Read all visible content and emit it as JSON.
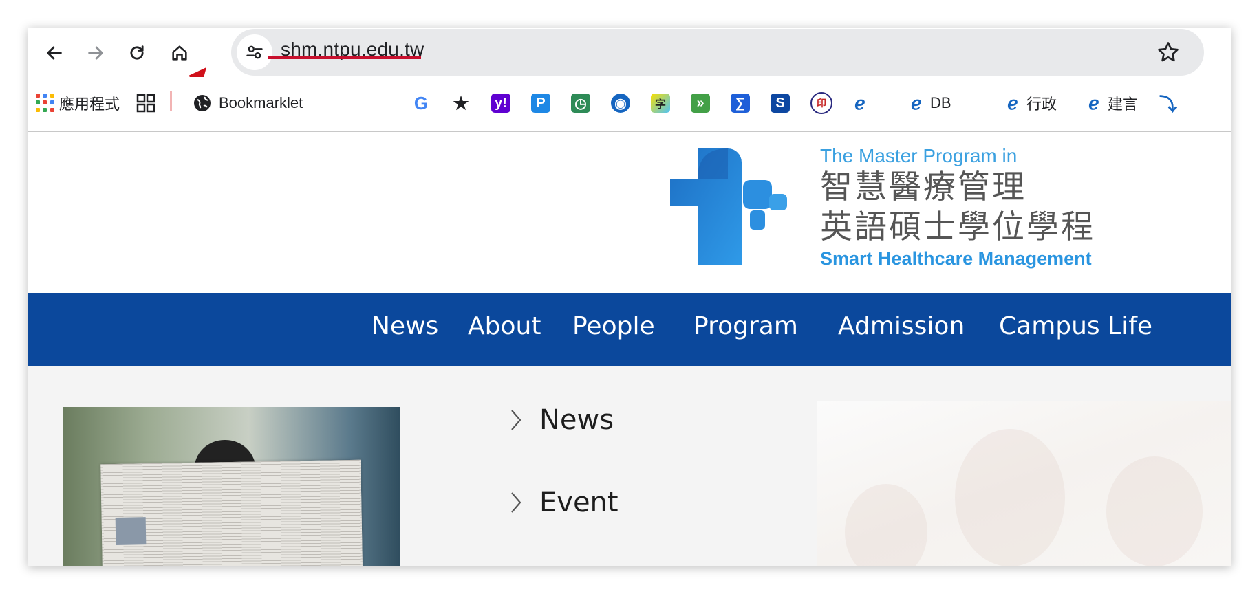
{
  "browser": {
    "url": "shm.ntpu.edu.tw",
    "bookmarks": [
      {
        "icon": "apps-grid-icon",
        "label": "應用程式"
      },
      {
        "icon": "grid-icon",
        "label": ""
      },
      {
        "icon": "globe-icon",
        "label": "Bookmarklet"
      },
      {
        "icon": "google-icon",
        "label": "",
        "glyph": "G",
        "color": "#4285f4"
      },
      {
        "icon": "star-icon",
        "label": "",
        "glyph": "★",
        "color": "#202124"
      },
      {
        "icon": "yahoo-icon",
        "label": "",
        "glyph": "y!",
        "color": "#5f01d1"
      },
      {
        "icon": "p-icon",
        "label": "",
        "glyph": "P",
        "color": "#1e88e5"
      },
      {
        "icon": "green-app-icon",
        "label": "",
        "glyph": "◷",
        "color": "#2e8b57"
      },
      {
        "icon": "eye-icon",
        "label": "",
        "glyph": "◉",
        "color": "#1565c0"
      },
      {
        "icon": "dictionary-icon",
        "label": "",
        "glyph": "字",
        "color": "#f1c40f"
      },
      {
        "icon": "forward-icon",
        "label": "",
        "glyph": "»",
        "color": "#43a047"
      },
      {
        "icon": "sigma-icon",
        "label": "",
        "glyph": "∑",
        "color": "#1e5fd8"
      },
      {
        "icon": "s-stack-icon",
        "label": "",
        "glyph": "S",
        "color": "#0d47a1"
      },
      {
        "icon": "seal-icon",
        "label": "",
        "glyph": "印",
        "color": "#c62828"
      },
      {
        "icon": "e-logo-icon",
        "label": "",
        "glyph": "ℯ",
        "color": "#1565c0"
      },
      {
        "icon": "e-logo-icon",
        "label": "DB",
        "glyph": "ℯ",
        "color": "#1565c0"
      },
      {
        "icon": "e-logo-icon",
        "label": "行政",
        "glyph": "ℯ",
        "color": "#1565c0"
      },
      {
        "icon": "e-logo-icon",
        "label": "建言",
        "glyph": "ℯ",
        "color": "#1565c0"
      },
      {
        "icon": "runner-icon",
        "label": "",
        "glyph": "⤵",
        "color": "#1565c0"
      }
    ]
  },
  "site": {
    "logo_en_top": "The Master Program in",
    "logo_zh_line1": "智慧醫療管理",
    "logo_zh_line2": "英語碩士學位學程",
    "logo_en_bottom": "Smart Healthcare Management",
    "nav": [
      "News",
      "About",
      "People",
      "Program",
      "Admission",
      "Campus Life"
    ],
    "side_links": [
      "News",
      "Event"
    ],
    "colors": {
      "nav_bg": "#0b489c",
      "accent_light": "#3aa0e0"
    }
  }
}
